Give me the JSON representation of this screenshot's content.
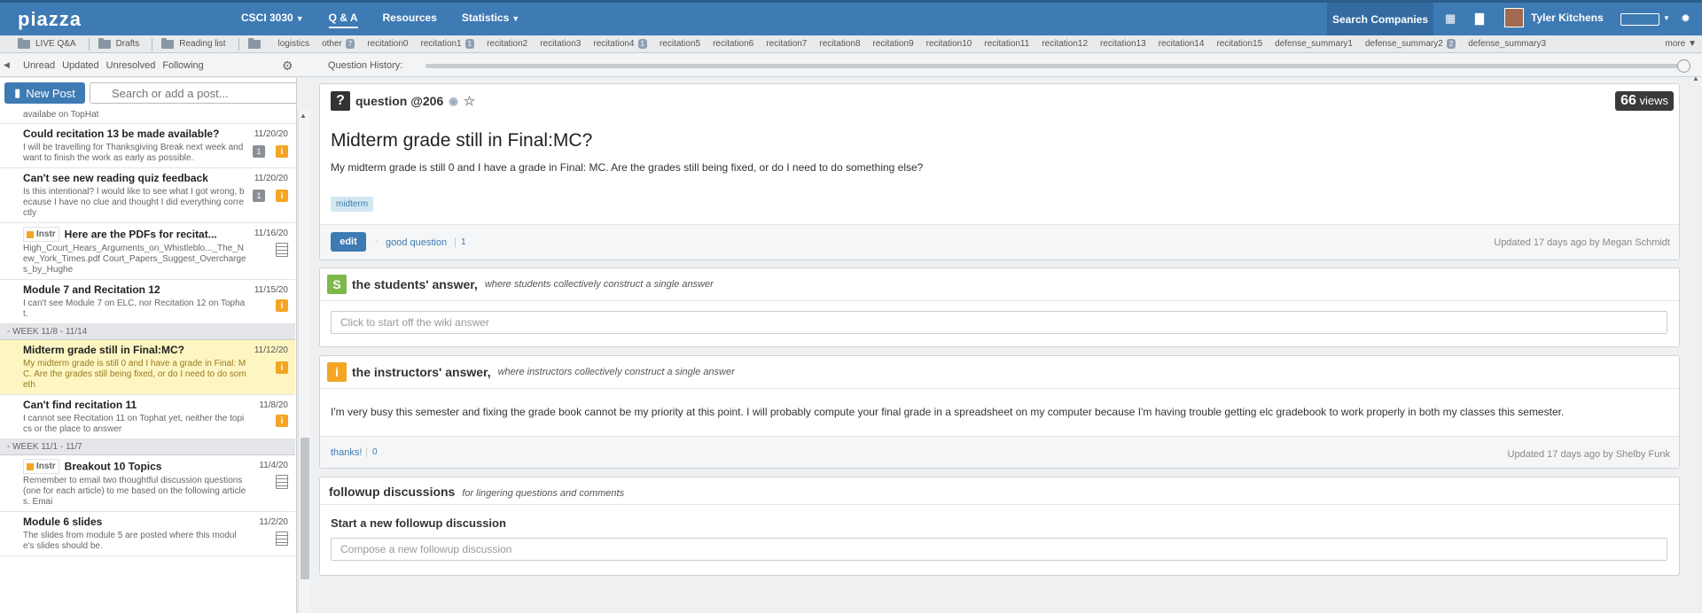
{
  "app": {
    "logo": "piazza"
  },
  "nav": {
    "course": "CSCI 3030",
    "qa": "Q & A",
    "resources": "Resources",
    "statistics": "Statistics",
    "search_companies": "Search Companies",
    "user_name": "Tyler Kitchens"
  },
  "folders": {
    "live_qa": "LIVE Q&A",
    "drafts": "Drafts",
    "reading_list": "Reading list",
    "items": [
      {
        "label": "logistics",
        "badge": ""
      },
      {
        "label": "other",
        "badge": "7"
      },
      {
        "label": "recitation0",
        "badge": ""
      },
      {
        "label": "recitation1",
        "badge": "1"
      },
      {
        "label": "recitation2",
        "badge": ""
      },
      {
        "label": "recitation3",
        "badge": ""
      },
      {
        "label": "recitation4",
        "badge": "1"
      },
      {
        "label": "recitation5",
        "badge": ""
      },
      {
        "label": "recitation6",
        "badge": ""
      },
      {
        "label": "recitation7",
        "badge": ""
      },
      {
        "label": "recitation8",
        "badge": ""
      },
      {
        "label": "recitation9",
        "badge": ""
      },
      {
        "label": "recitation10",
        "badge": ""
      },
      {
        "label": "recitation11",
        "badge": ""
      },
      {
        "label": "recitation12",
        "badge": ""
      },
      {
        "label": "recitation13",
        "badge": ""
      },
      {
        "label": "recitation14",
        "badge": ""
      },
      {
        "label": "recitation15",
        "badge": ""
      },
      {
        "label": "defense_summary1",
        "badge": ""
      },
      {
        "label": "defense_summary2",
        "badge": "2"
      },
      {
        "label": "defense_summary3",
        "badge": ""
      }
    ],
    "more": "more ▼"
  },
  "filters": {
    "unread": "Unread",
    "updated": "Updated",
    "unresolved": "Unresolved",
    "following": "Following",
    "question_history": "Question History:"
  },
  "feed": {
    "new_post": "New Post",
    "search_placeholder": "Search or add a post...",
    "top_snip": "availabe on TopHat",
    "week1": "WEEK 11/8 - 11/14",
    "week2": "WEEK 11/1 - 11/7",
    "posts": [
      {
        "title": "Could recitation 13 be made available?",
        "snippet": "I will be travelling for Thanksgiving Break next week and want to finish the work as early as possible.",
        "date": "11/20/20",
        "count": "1"
      },
      {
        "title": "Can't see new reading quiz feedback",
        "snippet": "Is this intentional? I would like to see what I got wrong, because I have no clue and thought I did everything correctly",
        "date": "11/20/20",
        "count": "1"
      },
      {
        "title": "Here are the PDFs for recitat...",
        "snippet": "High_Court_Hears_Arguments_on_Whistleblo..._The_New_York_Times.pdf Court_Papers_Suggest_Overcharges_by_Hughe",
        "date": "11/16/20",
        "instr": "Instr"
      },
      {
        "title": "Module 7 and Recitation 12",
        "snippet": "I can't see Module 7 on ELC, nor Recitation 12 on Tophat.",
        "date": "11/15/20"
      },
      {
        "title": "Midterm grade still in Final:MC?",
        "snippet": "My midterm grade is still 0 and I have a grade in Final: MC. Are the grades still being fixed, or do I need to do someth",
        "date": "11/12/20"
      },
      {
        "title": "Can't find recitation 11",
        "snippet": "I cannot see Recitation 11 on Tophat yet, neither the topics or the place to answer",
        "date": "11/8/20"
      },
      {
        "title": "Breakout 10 Topics",
        "snippet": "Remember to email two thoughtful discussion questions (one for each article) to me based on the following articles. Emai",
        "date": "11/4/20",
        "instr": "Instr"
      },
      {
        "title": "Module 6 slides",
        "snippet": "The slides from module 5 are posted where this module's slides should be.",
        "date": "11/2/20"
      }
    ]
  },
  "question": {
    "label": "question @206",
    "views_num": "66",
    "views_label": "views",
    "title": "Midterm grade still in Final:MC?",
    "body": "My midterm grade is still 0 and I have a grade in Final: MC. Are the grades still being fixed, or do I need to do something else?",
    "tag": "midterm",
    "edit": "edit",
    "good_question": "good question",
    "good_question_count": "1",
    "updated": "Updated 17 days ago by Megan Schmidt"
  },
  "students_answer": {
    "title": "the students' answer,",
    "subtitle": "where students collectively construct a single answer",
    "placeholder": "Click to start off the wiki answer"
  },
  "instructors_answer": {
    "title": "the instructors' answer,",
    "subtitle": "where instructors collectively construct a single answer",
    "body": "I'm very busy this semester and fixing the grade book cannot be my priority at this point. I will probably compute your final grade in a spreadsheet on my computer because I'm having trouble getting elc gradebook to work properly in both my classes this semester.",
    "thanks": "thanks!",
    "thanks_count": "0",
    "updated": "Updated 17 days ago by Shelby Funk"
  },
  "followup": {
    "title": "followup discussions",
    "subtitle": "for lingering questions and comments",
    "start": "Start a new followup discussion",
    "placeholder": "Compose a new followup discussion"
  },
  "colors": {
    "brand": "#3e7ab3",
    "instructor": "#f4a524",
    "student": "#7eb84b",
    "selected": "#fdf6c2"
  }
}
